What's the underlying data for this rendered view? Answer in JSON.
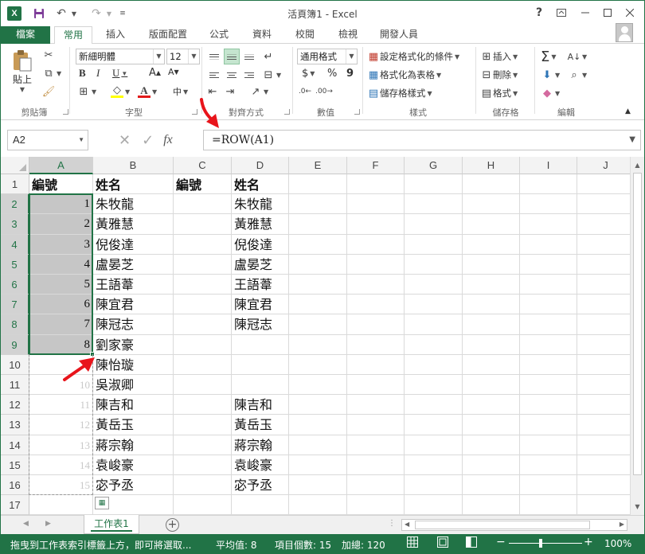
{
  "window": {
    "title": "活頁簿1 - Excel",
    "help": "?",
    "app_icon": "X"
  },
  "tabs": [
    "檔案",
    "常用",
    "插入",
    "版面配置",
    "公式",
    "資料",
    "校閱",
    "檢視",
    "開發人員"
  ],
  "ribbon": {
    "clipboard": {
      "paste": "貼上",
      "label": "剪貼簿"
    },
    "font": {
      "name": "新細明體",
      "size": "12",
      "bold": "B",
      "italic": "I",
      "underline": "U",
      "grow": "A",
      "shrink": "A",
      "font_color": "A",
      "phonetic": "中",
      "label": "字型"
    },
    "alignment": {
      "label": "對齊方式"
    },
    "number": {
      "format": "通用格式",
      "currency": "$",
      "percent": "%",
      "comma": "9",
      "label": "數值"
    },
    "styles": {
      "conditional": "設定格式化的條件",
      "table": "格式化為表格",
      "cell_styles": "儲存格樣式",
      "label": "樣式"
    },
    "cells": {
      "insert": "插入",
      "delete": "刪除",
      "format": "格式",
      "label": "儲存格"
    },
    "editing": {
      "label": "編輯"
    }
  },
  "formula_bar": {
    "name_box": "A2",
    "formula": "=ROW(A1)",
    "fx": "fx"
  },
  "grid": {
    "columns": [
      "A",
      "B",
      "C",
      "D",
      "E",
      "F",
      "G",
      "H",
      "I",
      "J"
    ],
    "rows": [
      "1",
      "2",
      "3",
      "4",
      "5",
      "6",
      "7",
      "8",
      "9",
      "10",
      "11",
      "12",
      "13",
      "14",
      "15",
      "16",
      "17"
    ],
    "headers": {
      "a1": "編號",
      "b1": "姓名",
      "c1": "編號",
      "d1": "姓名"
    },
    "col_a": [
      "1",
      "2",
      "3",
      "4",
      "5",
      "6",
      "7",
      "8",
      "9",
      "10",
      "11",
      "12",
      "13",
      "14",
      "15"
    ],
    "col_b": [
      "朱牧龍",
      "黃雅慧",
      "倪俊達",
      "盧晏芝",
      "王語葦",
      "陳宜君",
      "陳冠志",
      "劉家豪",
      "陳怡璇",
      "吳淑卿",
      "陳吉和",
      "黃岳玉",
      "蔣宗翰",
      "袁峻豪",
      "宓予丞"
    ],
    "col_d": [
      "朱牧龍",
      "黃雅慧",
      "倪俊達",
      "盧晏芝",
      "王語葦",
      "陳宜君",
      "陳冠志",
      "",
      "",
      "",
      "陳吉和",
      "黃岳玉",
      "蔣宗翰",
      "袁峻豪",
      "宓予丞"
    ]
  },
  "sheet": {
    "name": "工作表1",
    "add": "+"
  },
  "status": {
    "message": "拖曳到工作表索引標籤上方，即可將選取...",
    "average": "平均值: 8",
    "count": "項目個數: 15",
    "sum": "加總: 120",
    "zoom": "100%",
    "zoom_minus": "−",
    "zoom_plus": "+"
  },
  "colors": {
    "accent": "#217346",
    "arrow": "#e8141b",
    "selection_fill": "#c6c6c6"
  }
}
